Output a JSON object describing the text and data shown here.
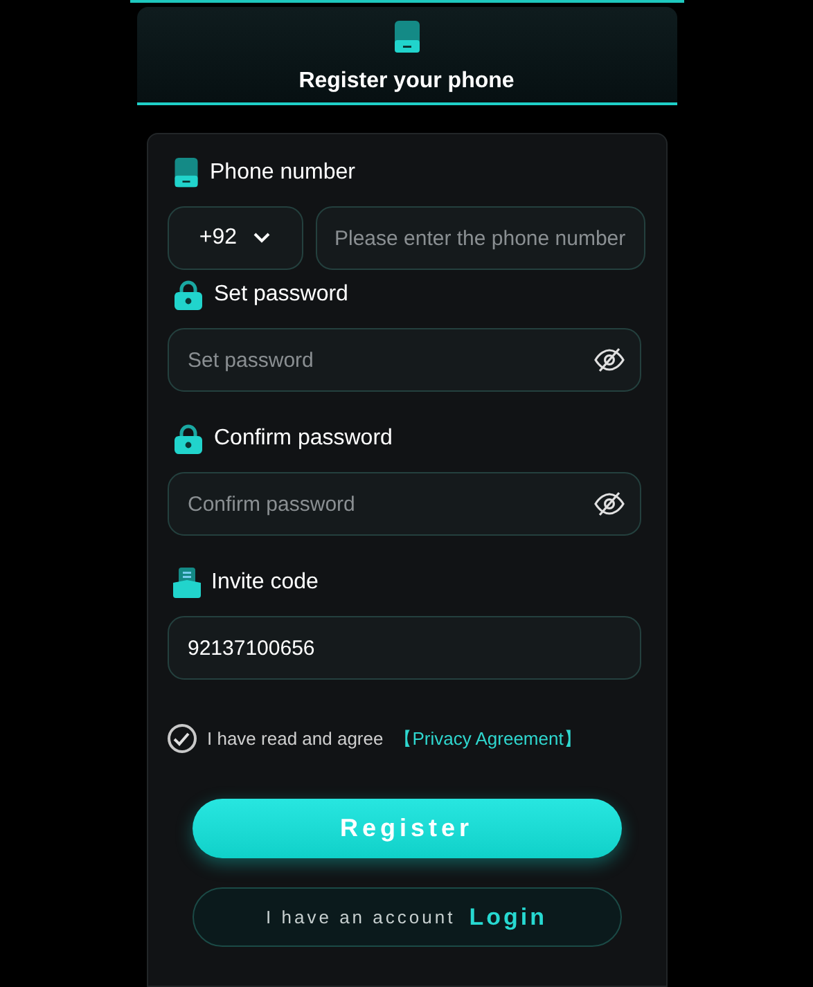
{
  "header": {
    "title": "Register your phone"
  },
  "form": {
    "fields": [
      {
        "kind": "phone",
        "label": "Phone number",
        "country_code": "+92",
        "placeholder": "Please enter the phone number"
      },
      {
        "kind": "password",
        "label": "Set password",
        "placeholder": "Set password"
      },
      {
        "kind": "password",
        "label": "Confirm password",
        "placeholder": "Confirm password"
      },
      {
        "kind": "invite",
        "label": "Invite code",
        "value": "92137100656"
      }
    ],
    "agreement": {
      "checked": true,
      "text": "I have read and agree",
      "link": "【Privacy Agreement】"
    },
    "register_button": "Register",
    "login_prompt": {
      "text": "I have an account",
      "link": "Login"
    }
  }
}
